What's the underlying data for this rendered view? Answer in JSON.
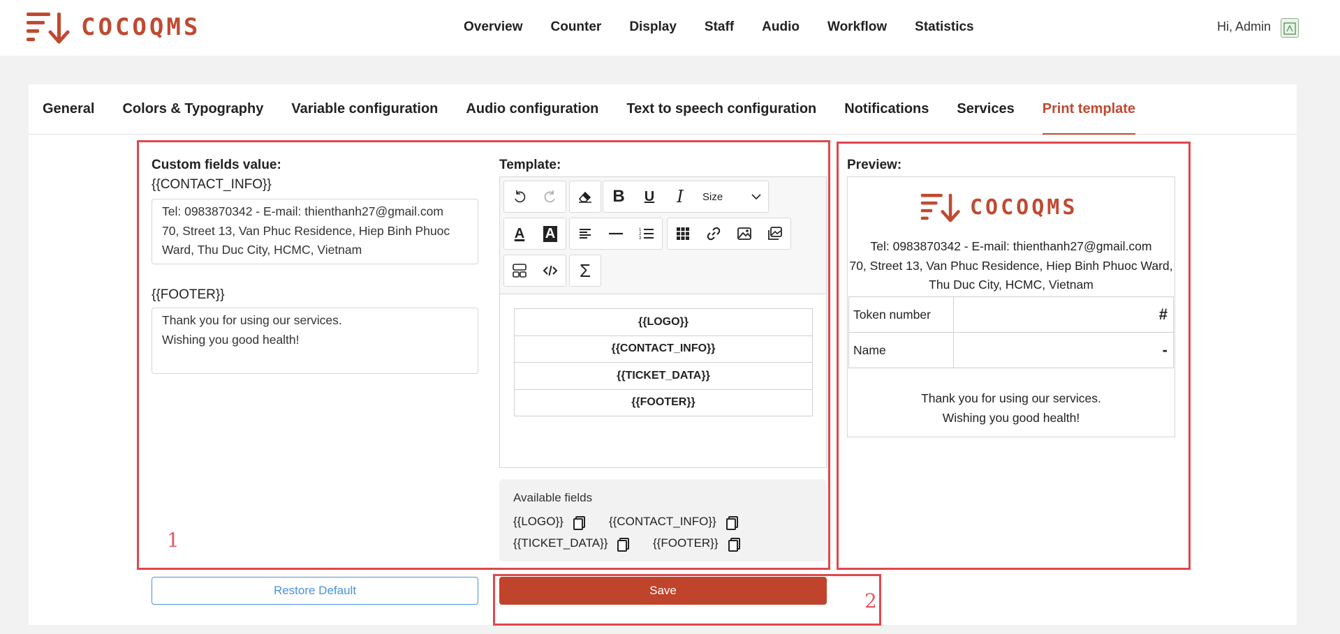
{
  "brand": {
    "name": "COCOQMS",
    "color": "#bf4a31"
  },
  "nav": {
    "items": [
      "Overview",
      "Counter",
      "Display",
      "Staff",
      "Audio",
      "Workflow",
      "Statistics"
    ]
  },
  "user": {
    "greeting": "Hi, Admin",
    "avatar_icon": "avatar-icon"
  },
  "tabs": {
    "items": [
      "General",
      "Colors & Typography",
      "Variable configuration",
      "Audio configuration",
      "Text to speech configuration",
      "Notifications",
      "Services",
      "Print template"
    ],
    "active": "Print template"
  },
  "custom_fields": {
    "title": "Custom fields value:",
    "contact_key": "{{CONTACT_INFO}}",
    "contact_value": "Tel: 0983870342 - E-mail: thienthanh27@gmail.com\n70, Street 13, Van Phuc Residence, Hiep Binh Phuoc\nWard, Thu Duc City, HCMC, Vietnam",
    "footer_key": "{{FOOTER}}",
    "footer_value": "Thank you for using our services.\nWishing you good health!"
  },
  "template": {
    "title": "Template:",
    "toolbar": {
      "undo": "undo-icon",
      "redo": "redo-icon",
      "eraser": "eraser-icon",
      "bold": "B",
      "underline": "U",
      "italic": "I",
      "size_label": "Size",
      "font_color": "A",
      "highlight": "A",
      "align": "align-left-icon",
      "hr": "horizontal-rule-icon",
      "list": "ordered-list-icon",
      "table": "table-icon",
      "link": "link-icon",
      "image": "image-icon",
      "gallery": "gallery-icon",
      "template": "template-icon",
      "code": "code-view-icon",
      "math": "Σ"
    },
    "rows": [
      "{{LOGO}}",
      "{{CONTACT_INFO}}",
      "{{TICKET_DATA}}",
      "{{FOOTER}}"
    ]
  },
  "available_fields": {
    "title": "Available fields",
    "items": [
      "{{LOGO}}",
      "{{CONTACT_INFO}}",
      "{{TICKET_DATA}}",
      "{{FOOTER}}"
    ]
  },
  "preview": {
    "title": "Preview:",
    "contact": "Tel: 0983870342 - E-mail: thienthanh27@gmail.com\n70, Street 13, Van Phuc Residence, Hiep Binh Phuoc Ward,\nThu Duc City, HCMC, Vietnam",
    "rows": [
      {
        "key": "Token number",
        "value": "#"
      },
      {
        "key": "Name",
        "value": "-"
      }
    ],
    "footer": "Thank you for using our services.\nWishing you good health!"
  },
  "buttons": {
    "restore": "Restore Default",
    "save": "Save"
  },
  "annotations": {
    "one": "1",
    "two": "2"
  },
  "colors": {
    "accent": "#bf4a31",
    "save": "#c0432b",
    "link": "#4a90e2",
    "highlight": "#e0474c"
  }
}
